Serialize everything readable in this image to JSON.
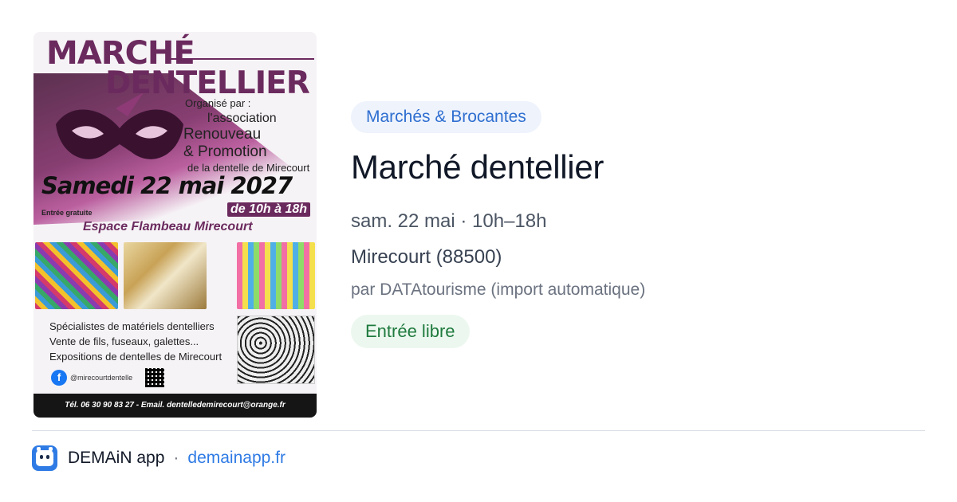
{
  "poster": {
    "title_line1": "MARCHÉ",
    "title_line2": "DENTELLIER",
    "organized_by": "Organisé par :",
    "association": "l'association",
    "org_name_1": "Renouveau",
    "org_name_2": "& Promotion",
    "org_tail": "de la dentelle de Mirecourt",
    "date": "Samedi 22 mai 2027",
    "entry": "Entrée gratuite",
    "hours": "de 10h à 18h",
    "venue": "Espace Flambeau Mirecourt",
    "list": [
      "Spécialistes de matériels dentelliers",
      "Vente de fils, fuseaux, galettes...",
      "Expositions de dentelles de Mirecourt"
    ],
    "facebook_handle": "@mirecourtdentelle",
    "contact": "Tél. 06 30 90 83 27 - Email. dentelledemirecourt@orange.fr"
  },
  "event": {
    "category": "Marchés & Brocantes",
    "title": "Marché dentellier",
    "when": "sam. 22 mai · 10h–18h",
    "where": "Mirecourt (88500)",
    "source": "par DATAtourisme (import automatique)",
    "price": "Entrée libre"
  },
  "footer": {
    "app_name": "DEMAiN app",
    "separator": "·",
    "domain": "demainapp.fr"
  },
  "colors": {
    "accent": "#2f7be5",
    "badge_bg": "#eef3fc",
    "price_bg": "#ecf8ef",
    "price_text": "#1f7a3e",
    "poster_purple": "#6b2a5e"
  },
  "icons": {
    "app": "demain-app-icon",
    "facebook": "facebook-icon",
    "qr": "qr-code-icon"
  }
}
